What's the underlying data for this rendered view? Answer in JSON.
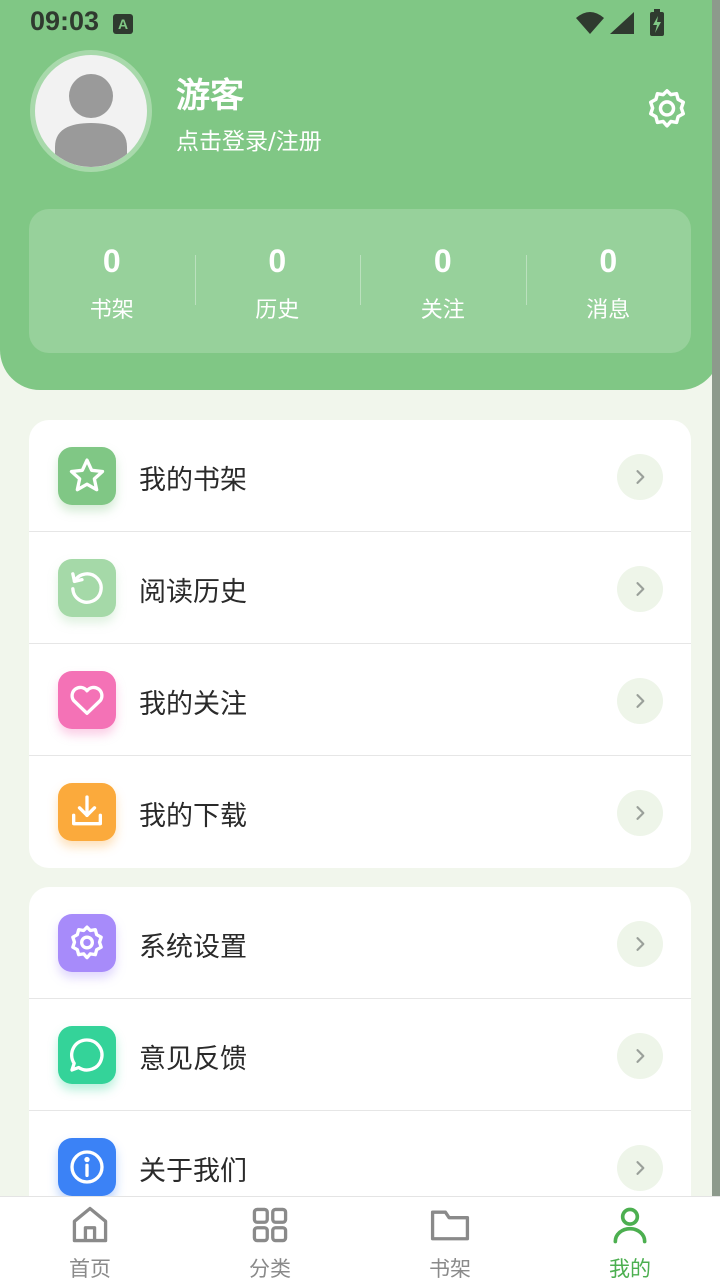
{
  "status_bar": {
    "time": "09:03",
    "indicator": "A"
  },
  "profile": {
    "name": "游客",
    "subtitle": "点击登录/注册",
    "avatar_icon": "person-avatar-icon",
    "settings_icon": "gear-icon"
  },
  "stats": [
    {
      "value": "0",
      "label": "书架"
    },
    {
      "value": "0",
      "label": "历史"
    },
    {
      "value": "0",
      "label": "关注"
    },
    {
      "value": "0",
      "label": "消息"
    }
  ],
  "menu_group_1": [
    {
      "label": "我的书架",
      "icon": "star-icon",
      "color": "#80c785"
    },
    {
      "label": "阅读历史",
      "icon": "history-icon",
      "color": "#a5d9a8"
    },
    {
      "label": "我的关注",
      "icon": "heart-icon",
      "color": "#f472b6"
    },
    {
      "label": "我的下载",
      "icon": "download-icon",
      "color": "#fbaa3c"
    }
  ],
  "menu_group_2": [
    {
      "label": "系统设置",
      "icon": "gear-icon",
      "color": "#a78bfa"
    },
    {
      "label": "意见反馈",
      "icon": "chat-bubble-icon",
      "color": "#34d399"
    },
    {
      "label": "关于我们",
      "icon": "info-icon",
      "color": "#3b82f6"
    }
  ],
  "bottom_nav": [
    {
      "label": "首页",
      "icon": "home-icon",
      "active": false
    },
    {
      "label": "分类",
      "icon": "grid-icon",
      "active": false
    },
    {
      "label": "书架",
      "icon": "folder-icon",
      "active": false
    },
    {
      "label": "我的",
      "icon": "user-icon",
      "active": true
    }
  ],
  "colors": {
    "header": "#80c785",
    "background": "#f1f6ec",
    "active_nav": "#4caf50",
    "inactive_nav": "#8a8a8a"
  }
}
